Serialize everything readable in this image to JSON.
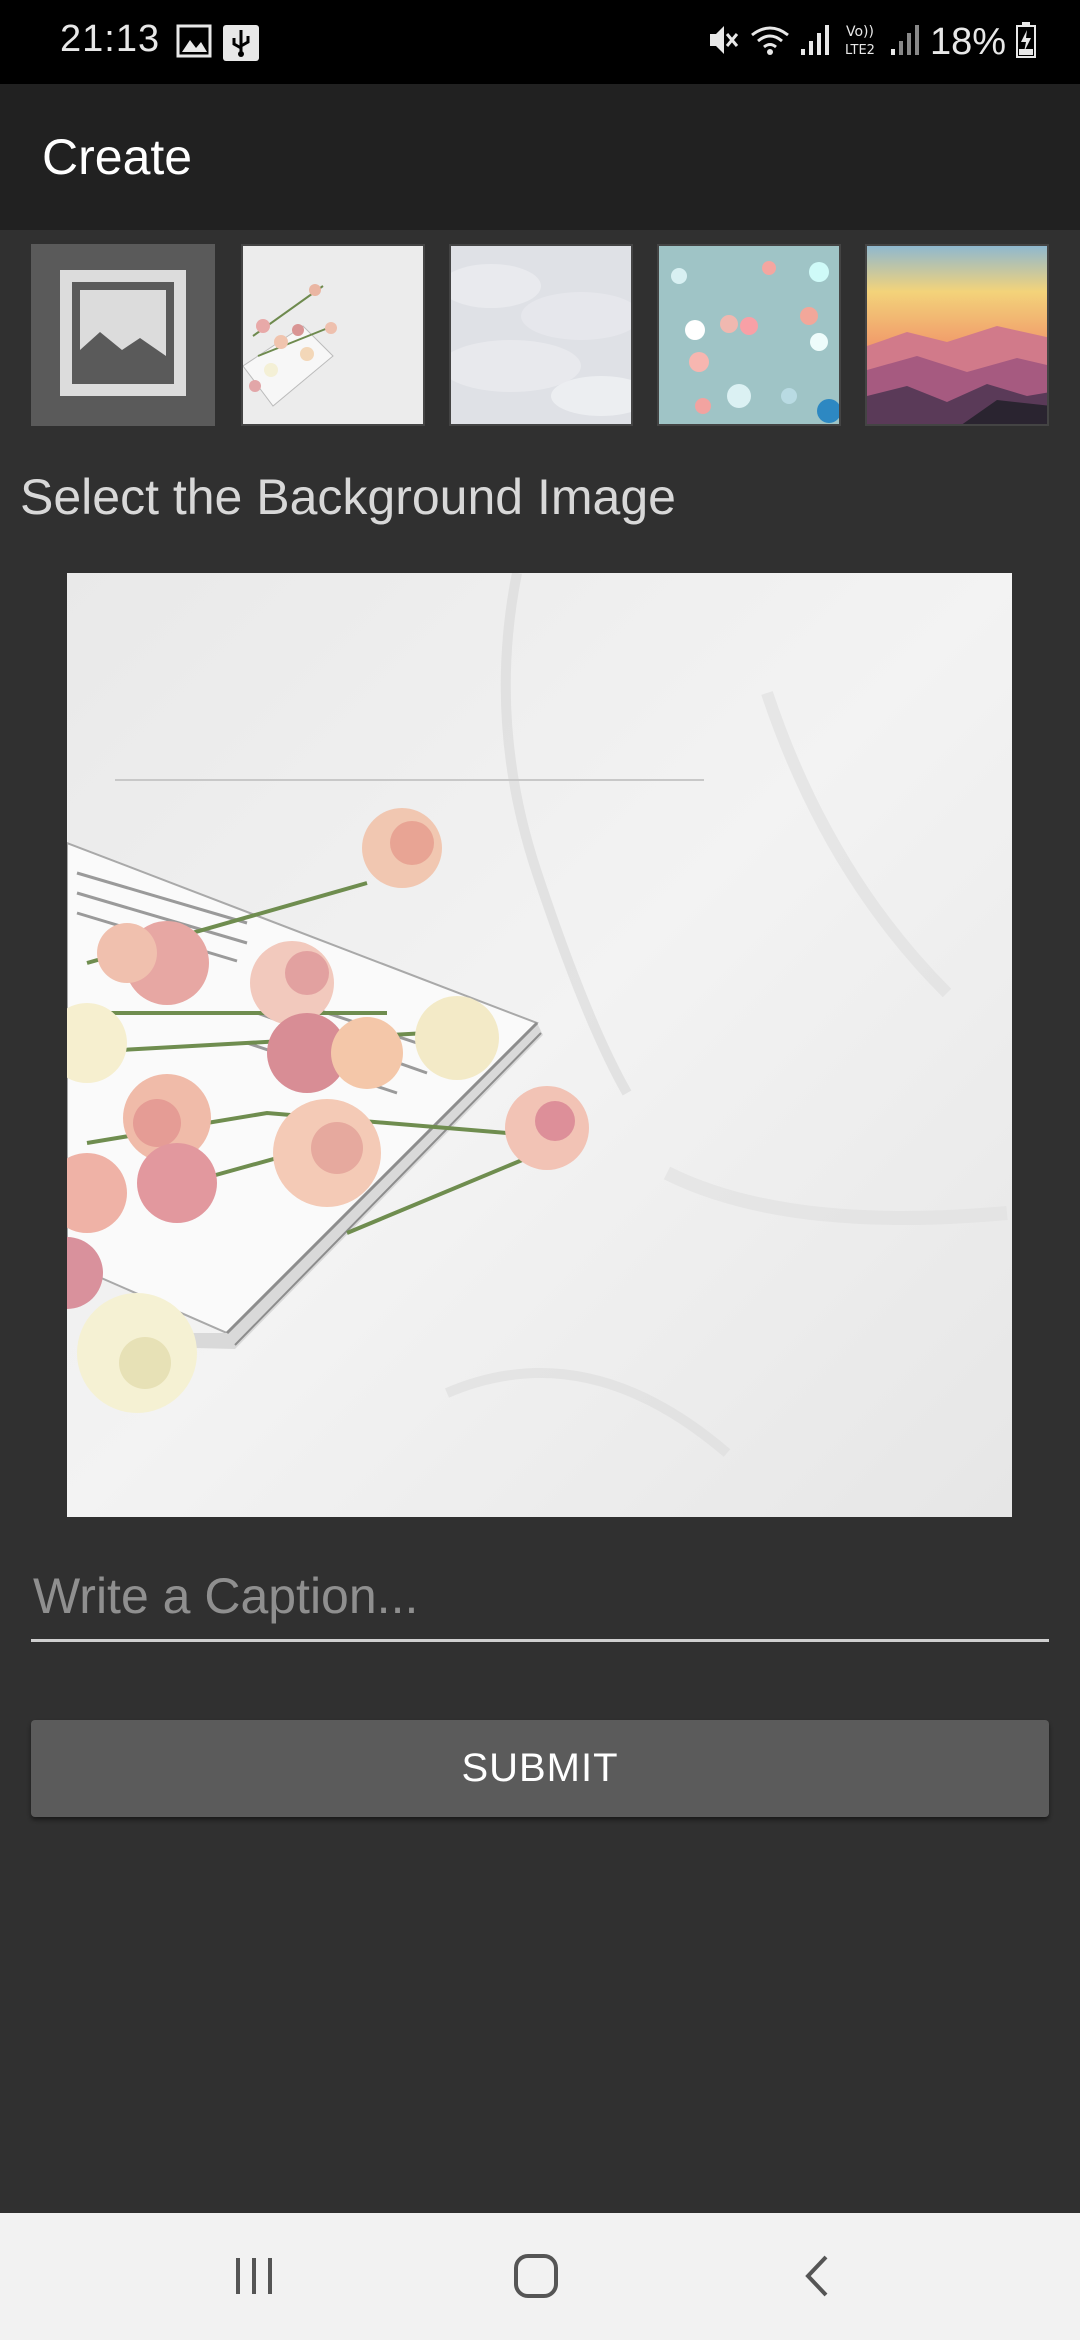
{
  "status_bar": {
    "time": "21:13",
    "battery": "18%",
    "left_icons": [
      "image-notification-icon",
      "usb-icon"
    ],
    "right_icons": [
      "mute-icon",
      "wifi-icon",
      "signal-icon",
      "volte-lte2-icon",
      "signal-2-icon",
      "battery-charging-icon"
    ]
  },
  "app_bar": {
    "title": "Create"
  },
  "thumbnails": [
    {
      "name": "placeholder-image",
      "icon": "image-placeholder-icon"
    },
    {
      "name": "flowers-on-sheet"
    },
    {
      "name": "white-snow"
    },
    {
      "name": "bokeh-lights"
    },
    {
      "name": "mountain-sunset"
    }
  ],
  "section_label": "Select the Background Image",
  "caption": {
    "placeholder": "Write a Caption...",
    "value": ""
  },
  "submit_label": "SUBMIT",
  "nav_bar": {
    "icons": [
      "recent-apps-icon",
      "home-icon",
      "back-icon"
    ]
  },
  "colors": {
    "background": "#303030",
    "app_bar": "#212121",
    "button": "#5b5b5b",
    "nav_bar": "#f2f2f2"
  }
}
